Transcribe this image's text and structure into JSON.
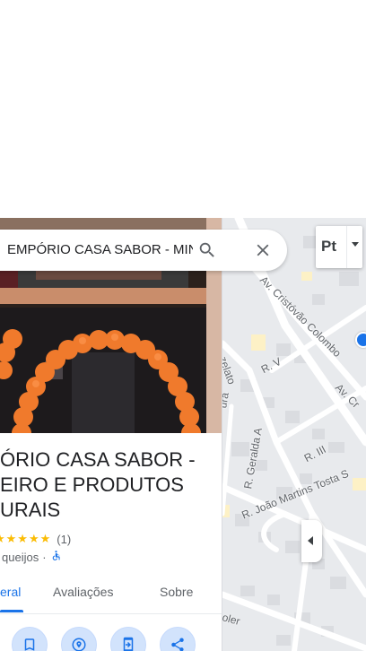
{
  "search": {
    "query": "EMPÓRIO CASA SABOR - MINI",
    "search_icon": "search-icon",
    "close_icon": "close-icon"
  },
  "place": {
    "title_lines": [
      "EMPÓRIO CASA SABOR -",
      "QUEIJEIRO E PRODUTOS",
      "NATURAIS"
    ],
    "title_visible": [
      "ÓRIO CASA SABOR -",
      "EIRO E PRODUTOS",
      "URAIS"
    ],
    "stars": "★★★★★",
    "rating_count": "(1)",
    "category": "queijos",
    "separator": "·"
  },
  "tabs": [
    {
      "label": "eral",
      "active": true
    },
    {
      "label": "Avaliações",
      "active": false
    },
    {
      "label": "Sobre",
      "active": false
    }
  ],
  "actions": [
    {
      "icon": "bookmark-icon"
    },
    {
      "icon": "nearby-icon"
    },
    {
      "icon": "send-to-phone-icon"
    },
    {
      "icon": "share-icon"
    }
  ],
  "map": {
    "streets": [
      "Av. Cristóvão Colombo",
      "Av. Cr",
      "R. V",
      "R. Geralda A",
      "R. III",
      "R. João Martins Tosta S",
      "zelato",
      "ura",
      "oler"
    ],
    "layer_button_label": "Pt"
  },
  "colors": {
    "accent": "#1a73e8",
    "star": "#fbbc04",
    "map_bg": "#e8eaed"
  }
}
